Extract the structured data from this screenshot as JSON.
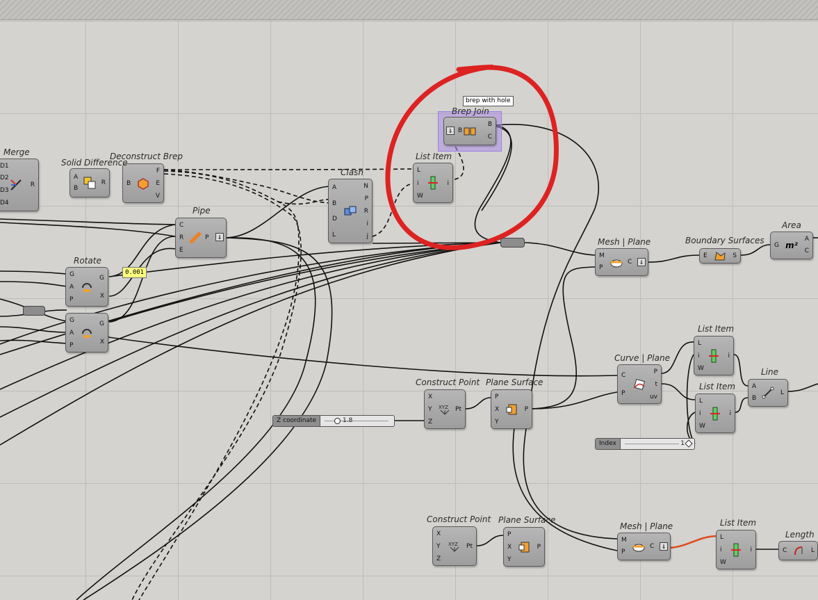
{
  "tooltip": "brep with hole",
  "panel_value": "0.001",
  "components": {
    "merge": {
      "title": "Merge",
      "inputs": [
        "D1",
        "D2",
        "D3",
        "D4"
      ],
      "outputs": [
        "R"
      ]
    },
    "solid_difference": {
      "title": "Solid Difference",
      "inputs": [
        "A",
        "B"
      ],
      "outputs": [
        "R"
      ]
    },
    "deconstruct_brep": {
      "title": "Deconstruct Brep",
      "inputs": [
        "B"
      ],
      "outputs": [
        "F",
        "E",
        "V"
      ]
    },
    "clash": {
      "title": "Clash",
      "inputs": [
        "A",
        "B",
        "D",
        "L"
      ],
      "outputs": [
        "N",
        "P",
        "R",
        "i",
        "j"
      ]
    },
    "list_item_1": {
      "title": "List Item",
      "inputs": [
        "L",
        "i",
        "W"
      ],
      "outputs": [
        "i"
      ]
    },
    "brep_join": {
      "title": "Brep Join",
      "inputs": [
        "B"
      ],
      "outputs": [
        "B",
        "C"
      ]
    },
    "pipe": {
      "title": "Pipe",
      "inputs": [
        "C",
        "R",
        "E"
      ],
      "outputs": [
        "P"
      ]
    },
    "rotate_1": {
      "title": "Rotate",
      "inputs": [
        "G",
        "A",
        "P"
      ],
      "outputs": [
        "G",
        "X"
      ]
    },
    "rotate_2": {
      "title": "",
      "inputs": [
        "G",
        "A",
        "P"
      ],
      "outputs": [
        "G",
        "X"
      ]
    },
    "mesh_plane_1": {
      "title": "Mesh | Plane",
      "inputs": [
        "M",
        "P"
      ],
      "outputs": [
        "C"
      ]
    },
    "boundary_surfaces": {
      "title": "Boundary Surfaces",
      "inputs": [
        "E"
      ],
      "outputs": [
        "S"
      ]
    },
    "area": {
      "title": "Area",
      "inputs": [
        "G"
      ],
      "outputs": [
        "A",
        "C"
      ],
      "icon": "m²"
    },
    "list_item_2": {
      "title": "List Item",
      "inputs": [
        "L",
        "i",
        "W"
      ],
      "outputs": [
        "i"
      ]
    },
    "curve_plane": {
      "title": "Curve | Plane",
      "inputs": [
        "C",
        "P"
      ],
      "outputs": [
        "P",
        "t",
        "uv"
      ]
    },
    "line": {
      "title": "Line",
      "inputs": [
        "A",
        "B"
      ],
      "outputs": [
        "L"
      ]
    },
    "list_item_3": {
      "title": "List Item",
      "inputs": [
        "L",
        "i",
        "W"
      ],
      "outputs": [
        "i"
      ]
    },
    "construct_point_1": {
      "title": "Construct Point",
      "inputs": [
        "X",
        "Y",
        "Z"
      ],
      "outputs": [
        "Pt"
      ]
    },
    "plane_surface_1": {
      "title": "Plane Surface",
      "inputs": [
        "P",
        "X",
        "Y"
      ],
      "outputs": [
        "P"
      ]
    },
    "construct_point_2": {
      "title": "Construct Point",
      "inputs": [
        "X",
        "Y",
        "Z"
      ],
      "outputs": [
        "Pt"
      ]
    },
    "plane_surface_2": {
      "title": "Plane Surface",
      "inputs": [
        "P",
        "X",
        "Y"
      ],
      "outputs": [
        "P"
      ]
    },
    "mesh_plane_2": {
      "title": "Mesh | Plane",
      "inputs": [
        "M",
        "P"
      ],
      "outputs": [
        "C"
      ]
    },
    "list_item_4": {
      "title": "List Item",
      "inputs": [
        "L",
        "i",
        "W"
      ],
      "outputs": [
        "i"
      ]
    },
    "length": {
      "title": "Length",
      "inputs": [
        "C"
      ],
      "outputs": [
        "L"
      ]
    }
  },
  "sliders": {
    "z_coordinate": {
      "label": "Z coordinate",
      "value": "1.8"
    },
    "index": {
      "label": "Index",
      "value": "1"
    }
  },
  "colors": {
    "annotation_circle": "#dd2222",
    "selection": "#aa8ce6",
    "canvas": "#d4d3cf",
    "highlight_wire": "#e04a1c"
  }
}
